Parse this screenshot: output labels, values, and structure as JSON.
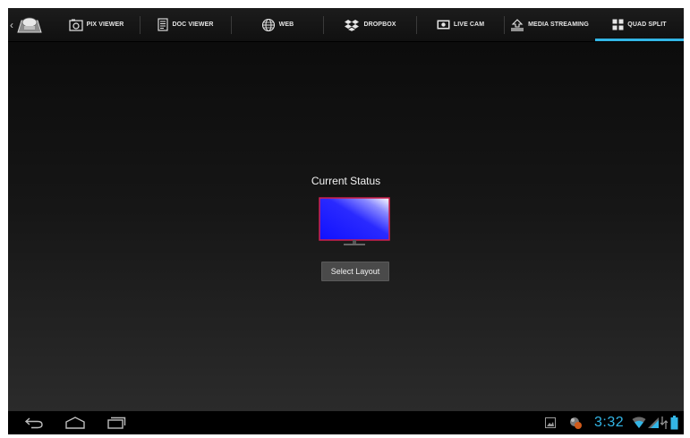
{
  "action_bar": {
    "up_caret": "‹",
    "logo_icon": "app-logo-icon",
    "tabs": [
      {
        "label": "PIX VIEWER",
        "icon": "photo-icon",
        "selected": false
      },
      {
        "label": "DOC VIEWER",
        "icon": "document-icon",
        "selected": false
      },
      {
        "label": "WEB",
        "icon": "globe-icon",
        "selected": false
      },
      {
        "label": "DROPBOX",
        "icon": "dropbox-icon",
        "selected": false
      },
      {
        "label": "LIVE CAM",
        "icon": "camera-icon",
        "selected": false
      },
      {
        "label": "MEDIA STREAMING",
        "icon": "streaming-icon",
        "selected": false
      },
      {
        "label": "QUAD SPLIT",
        "icon": "quad-grid-icon",
        "selected": true
      }
    ],
    "accent_color": "#33b5e5"
  },
  "main": {
    "status_title": "Current Status",
    "monitor_icon": "monitor-icon",
    "select_layout_label": "Select Layout"
  },
  "system_bar": {
    "nav": [
      "back-icon",
      "home-icon",
      "recent-apps-icon"
    ],
    "notifications": [
      "gallery-notification-icon",
      "app-notification-icon"
    ],
    "clock": "3:32",
    "status_icons": [
      "wifi-icon",
      "signal-icon",
      "battery-icon"
    ]
  }
}
